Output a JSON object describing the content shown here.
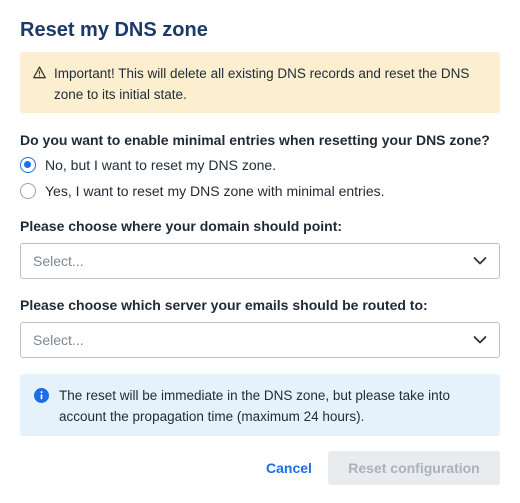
{
  "dialog": {
    "title": "Reset my DNS zone"
  },
  "warning": {
    "icon": "warning-triangle-icon",
    "text": "Important! This will delete all existing DNS records and reset the DNS zone to its initial state.",
    "background": "#fcefd0"
  },
  "minimal_entries": {
    "question": "Do you want to enable minimal entries when resetting your DNS zone?",
    "options": [
      {
        "label": "No, but I want to reset my DNS zone.",
        "checked": true
      },
      {
        "label": "Yes, I want to reset my DNS zone with minimal entries.",
        "checked": false
      }
    ]
  },
  "domain_point": {
    "label": "Please choose where your domain should point:",
    "placeholder": "Select..."
  },
  "email_server": {
    "label": "Please choose which server your emails should be routed to:",
    "placeholder": "Select..."
  },
  "info": {
    "icon": "info-circle-icon",
    "text": "The reset will be immediate in the DNS zone, but please take into account the propagation time (maximum 24 hours).",
    "background": "#e6f2fb"
  },
  "actions": {
    "cancel_label": "Cancel",
    "reset_label": "Reset configuration",
    "reset_enabled": false
  },
  "colors": {
    "accent": "#1a6ee8",
    "title": "#1b3a6b"
  }
}
